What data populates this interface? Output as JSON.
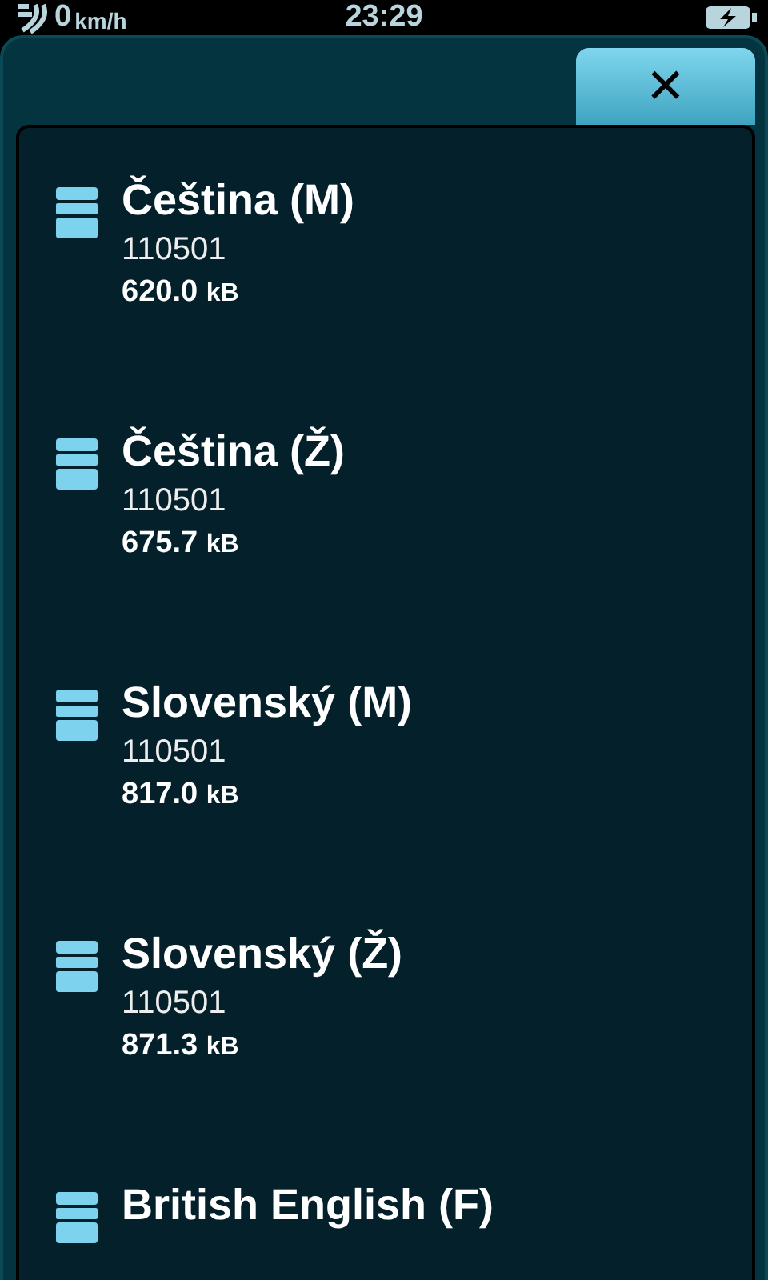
{
  "status_bar": {
    "speed": "0",
    "speed_unit": "km/h",
    "time": "23:29"
  },
  "close_button": {
    "label": "✕"
  },
  "voices": [
    {
      "name": "Čeština (M)",
      "version": "110501",
      "size": "620.0",
      "unit": "kB"
    },
    {
      "name": "Čeština (Ž)",
      "version": "110501",
      "size": "675.7",
      "unit": "kB"
    },
    {
      "name": "Slovenský (M)",
      "version": "110501",
      "size": "817.0",
      "unit": "kB"
    },
    {
      "name": "Slovenský (Ž)",
      "version": "110501",
      "size": "871.3",
      "unit": "kB"
    },
    {
      "name": "British English (F)"
    }
  ]
}
